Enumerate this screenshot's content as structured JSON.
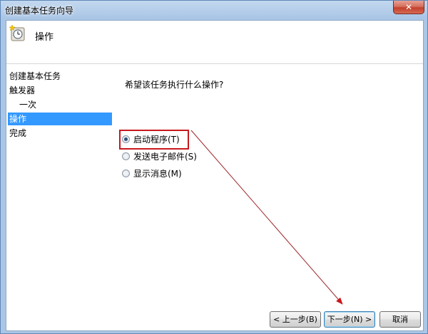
{
  "window": {
    "title": "创建基本任务向导",
    "close_glyph": "✕"
  },
  "header": {
    "title": "操作",
    "icon": "task-clock-icon"
  },
  "steps": [
    {
      "label": "创建基本任务",
      "selected": false,
      "indent": false
    },
    {
      "label": "触发器",
      "selected": false,
      "indent": false
    },
    {
      "label": "一次",
      "selected": false,
      "indent": true
    },
    {
      "label": "操作",
      "selected": true,
      "indent": false
    },
    {
      "label": "完成",
      "selected": false,
      "indent": false
    }
  ],
  "content": {
    "question": "希望该任务执行什么操作?",
    "options": [
      {
        "label": "启动程序(T)",
        "checked": true
      },
      {
        "label": "发送电子邮件(S)",
        "checked": false
      },
      {
        "label": "显示消息(M)",
        "checked": false
      }
    ]
  },
  "buttons": {
    "back": "< 上一步(B)",
    "next": "下一步(N) >",
    "cancel": "取消"
  },
  "colors": {
    "selection": "#3399ff",
    "highlight_box": "#c8181e",
    "annotation_arrow": "#a0282a"
  }
}
